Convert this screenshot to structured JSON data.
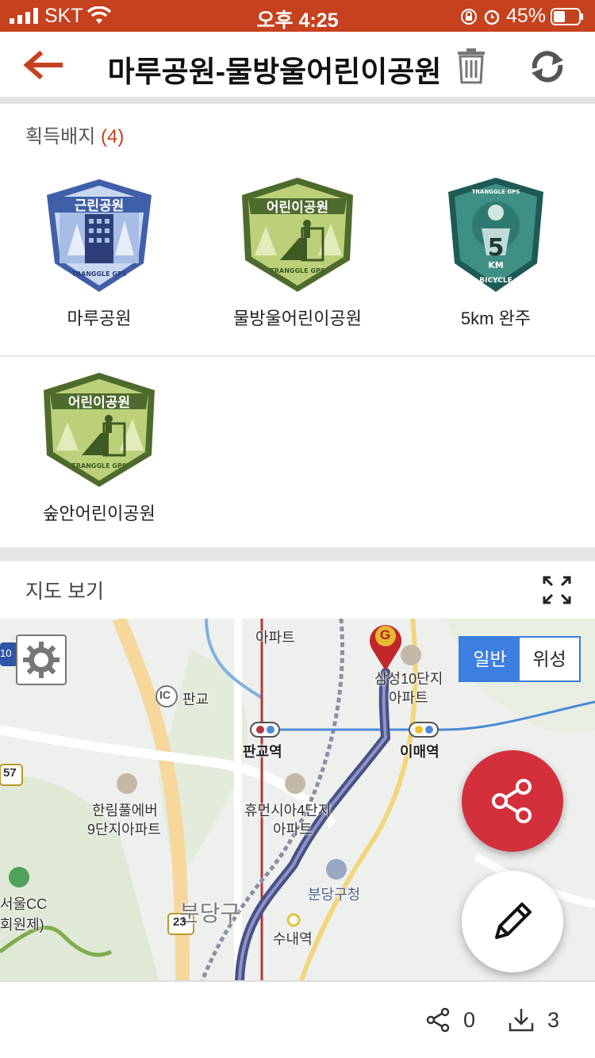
{
  "status_bar": {
    "carrier": "SKT",
    "time": "오후 4:25",
    "battery": "45%"
  },
  "header": {
    "title": "마루공원-물방울어린이공원"
  },
  "badges": {
    "title": "획득배지",
    "count": "(4)",
    "items": [
      {
        "label": "마루공원",
        "badge_text": "근린공원",
        "badge_sub": "TRANGGLE GPS"
      },
      {
        "label": "물방울어린이공원",
        "badge_text": "어린이공원",
        "badge_sub": "TRANGGLE GPS"
      },
      {
        "label": "5km 완주",
        "badge_text": "5",
        "badge_unit": "KM",
        "badge_top": "TRANGGLE GPS",
        "badge_bottom": "BICYCLE"
      },
      {
        "label": "숲안어린이공원",
        "badge_text": "어린이공원",
        "badge_sub": "TRANGGLE GPS"
      }
    ]
  },
  "map": {
    "title": "지도 보기",
    "type_normal": "일반",
    "type_satellite": "위성",
    "labels": {
      "apt_top": "아파트",
      "ic": "IC",
      "pangyo_ic": "판교",
      "pangyo_station": "판교역",
      "samsung_apt": "삼성10단지",
      "samsung_apt2": "아파트",
      "imae_station": "이매역",
      "hanrim": "한림풀에버",
      "hanrim2": "9단지아파트",
      "humansia": "휴먼시아4단지",
      "humansia2": "아파트",
      "bundang_gu_office": "분당구청",
      "bundang_gu": "분당구",
      "sunae_station": "수내역",
      "seoul_cc": "서울CC",
      "seoul_cc2": "회원제)",
      "road_57": "57",
      "road_23": "23",
      "road_10": "10",
      "goal_marker": "G"
    }
  },
  "footer": {
    "share_count": "0",
    "download_count": "3"
  },
  "colors": {
    "brand": "#c6411e",
    "route": "#4a4f86",
    "share_fab": "#d4303c",
    "map_type_active": "#3d7fe0"
  }
}
